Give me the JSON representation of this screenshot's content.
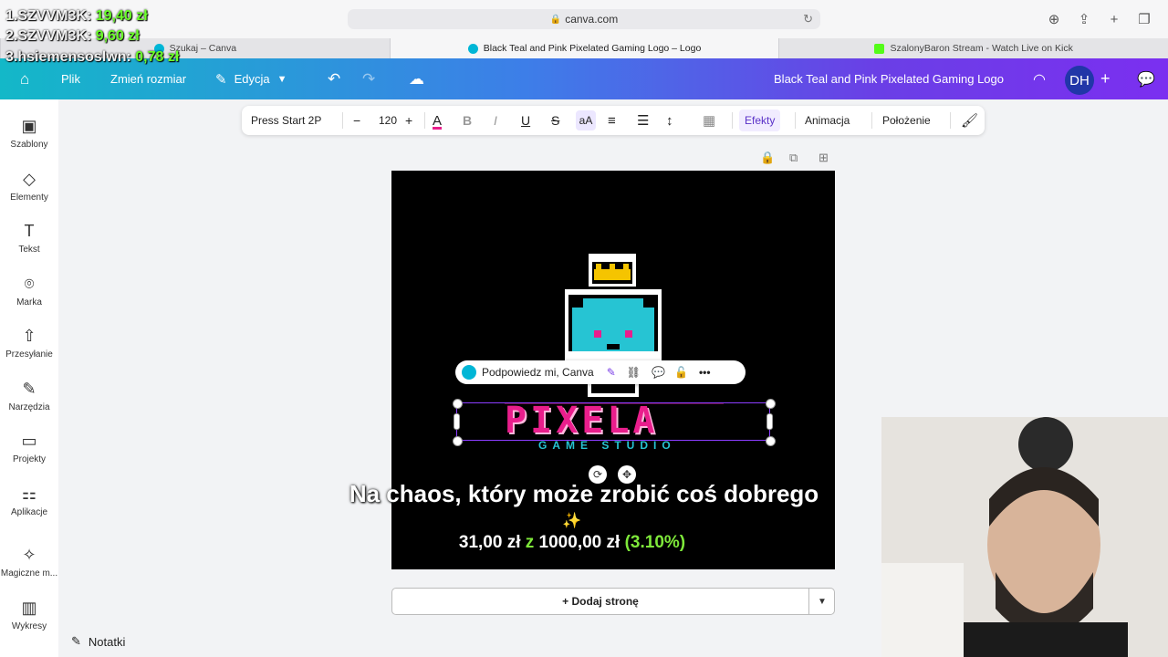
{
  "browser": {
    "url": "canva.com",
    "tabs": [
      {
        "label": "Szukaj – Canva",
        "favicon_color": "#00b6d6"
      },
      {
        "label": "Black Teal and Pink Pixelated Gaming Logo – Logo",
        "favicon_color": "#00b6d6"
      },
      {
        "label": "SzalonyBaron Stream - Watch Live on Kick",
        "favicon_color": "#53fc18"
      }
    ],
    "icons": [
      "download-icon",
      "share-icon",
      "new-tab-icon",
      "tab-overview-icon",
      "reload-icon",
      "lock-icon"
    ]
  },
  "overlay": {
    "leaderboard": [
      {
        "name": "1.SZVVM3K:",
        "amount": "19,40 zł"
      },
      {
        "name": "2.SZVVM3K:",
        "amount": "9,60 zł"
      },
      {
        "name": "3.hsiemensoslwn:",
        "amount": "0,78 zł"
      }
    ],
    "subtitle": "Na chaos, który może zrobić coś dobrego",
    "goal": {
      "current": "31,00 zł",
      "sep": "z",
      "target": "1000,00 zł",
      "percent": "(3.10%)"
    }
  },
  "header": {
    "file": "Plik",
    "resize": "Zmień rozmiar",
    "edit": "Edycja",
    "design_title": "Black Teal and Pink Pixelated Gaming Logo",
    "avatar": "DH",
    "colors": {
      "start": "#13b8c8",
      "end": "#7b2ff0"
    }
  },
  "sidebar": {
    "items": [
      {
        "label": "Szablony",
        "icon": "templates-icon"
      },
      {
        "label": "Elementy",
        "icon": "elements-icon"
      },
      {
        "label": "Tekst",
        "icon": "text-icon"
      },
      {
        "label": "Marka",
        "icon": "brand-icon"
      },
      {
        "label": "Przesyłanie",
        "icon": "upload-icon"
      },
      {
        "label": "Narzędzia",
        "icon": "tools-icon"
      },
      {
        "label": "Projekty",
        "icon": "projects-icon"
      },
      {
        "label": "Aplikacje",
        "icon": "apps-icon"
      },
      {
        "label": "Magiczne m...",
        "icon": "magic-icon"
      },
      {
        "label": "Wykresy",
        "icon": "charts-icon"
      }
    ]
  },
  "toolbar": {
    "font": "Press Start 2P",
    "font_size": "120",
    "case_label": "aA",
    "effects": "Efekty",
    "animation": "Animacja",
    "position": "Położenie"
  },
  "canvas": {
    "logo_text": "PIXELA",
    "logo_subtext": "GAME STUDIO",
    "prompt": "Podpowiedz mi, Canva",
    "colors": {
      "pink": "#e91e8c",
      "teal": "#26c4d3",
      "crown": "#f5c400"
    }
  },
  "footer": {
    "add_page": "+ Dodaj stronę",
    "notes": "Notatki"
  }
}
